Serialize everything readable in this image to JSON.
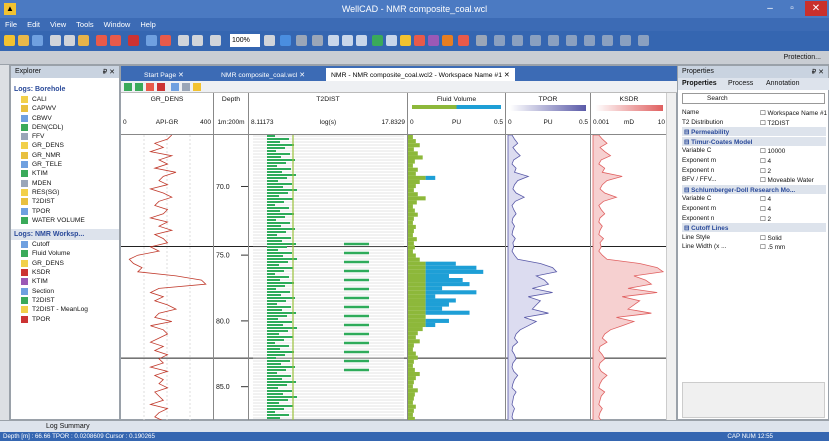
{
  "window": {
    "title": "WellCAD - NMR composite_coal.wcl",
    "minimize": "–",
    "maximize": "▫",
    "close": "✕"
  },
  "menu": [
    "File",
    "Edit",
    "View",
    "Tools",
    "Window",
    "Help"
  ],
  "toolbar": {
    "zoom": "100%"
  },
  "protection_label": "Protection...",
  "explorer": {
    "title": "Explorer",
    "pin": "₽ ✕",
    "borehole_title": "Logs: Borehole",
    "borehole_items": [
      "CALI",
      "CAPWV",
      "CBWV",
      "DEN(CDL)",
      "FFV",
      "GR_DENS",
      "GR_NMR",
      "GR_TELE",
      "KTIM",
      "MDEN",
      "RES(SG)",
      "T2DIST",
      "TPOR",
      "WATER VOLUME"
    ],
    "workspace_title": "Logs: NMR Worksp...",
    "workspace_items": [
      "Cutoff",
      "Fluid Volume",
      "GR_DENS",
      "KSDR",
      "KTIM",
      "Section",
      "T2DIST",
      "T2DIST - MeanLog",
      "TPOR"
    ]
  },
  "tabs": [
    "Start Page",
    "NMR composite_coal.wcl",
    "NMR - NMR composite_coal.wcl2 - Workspace Name #1"
  ],
  "tab_close": "✕",
  "columns": [
    {
      "name": "GR_DENS",
      "left": "0",
      "unit": "API-GR",
      "right": "400"
    },
    {
      "name": "Depth",
      "left": "",
      "unit": "1m:200m",
      "right": ""
    },
    {
      "name": "T2DIST",
      "left": "8.11173",
      "unit": "log(s)",
      "right": "17.8329"
    },
    {
      "name": "Fluid Volume",
      "left": "0",
      "unit": "PU",
      "right": "0.5"
    },
    {
      "name": "TPOR",
      "left": "0",
      "unit": "PU",
      "right": "0.5"
    },
    {
      "name": "KSDR",
      "left": "0.001",
      "unit": "mD",
      "right": "10"
    }
  ],
  "depth_labels": [
    "70.0",
    "75.0",
    "80.0",
    "85.0"
  ],
  "depth_fractions": [
    0.18,
    0.42,
    0.65,
    0.88
  ],
  "section_boundaries": [
    0.39,
    0.78
  ],
  "gr_curve": [
    0.55,
    0.5,
    0.35,
    0.45,
    0.3,
    0.55,
    0.4,
    0.5,
    0.35,
    0.6,
    0.45,
    0.4,
    0.5,
    0.3,
    0.45,
    0.55,
    0.4,
    0.35,
    0.5,
    0.45,
    0.3,
    0.5,
    0.4,
    0.55,
    0.35,
    0.45,
    0.5,
    0.3,
    0.4,
    0.15,
    0.05,
    0.1,
    0.2,
    0.15,
    0.6,
    0.9,
    0.95,
    0.4,
    0.3,
    0.45,
    0.35,
    0.5,
    0.6,
    0.4,
    0.35,
    0.55,
    0.3,
    0.45,
    0.5,
    0.4,
    0.3,
    0.45,
    0.35,
    0.5,
    0.4,
    0.45,
    0.3,
    0.5,
    0.35,
    0.45,
    0.4,
    0.5,
    0.35,
    0.4,
    0.45,
    0.3,
    0.5,
    0.4,
    0.35,
    0.45
  ],
  "tpor_curve": [
    0.05,
    0.08,
    0.12,
    0.06,
    0.1,
    0.15,
    0.07,
    0.05,
    0.1,
    0.08,
    0.25,
    0.12,
    0.08,
    0.06,
    0.1,
    0.2,
    0.09,
    0.05,
    0.07,
    0.1,
    0.06,
    0.05,
    0.08,
    0.06,
    0.05,
    0.09,
    0.06,
    0.07,
    0.05,
    0.08,
    0.12,
    0.4,
    0.55,
    0.6,
    0.35,
    0.45,
    0.5,
    0.3,
    0.55,
    0.25,
    0.4,
    0.35,
    0.3,
    0.5,
    0.2,
    0.35,
    0.25,
    0.15,
    0.1,
    0.08,
    0.12,
    0.06,
    0.05,
    0.08,
    0.1,
    0.06,
    0.05,
    0.07,
    0.12,
    0.08,
    0.06,
    0.05,
    0.1,
    0.07,
    0.06,
    0.05,
    0.08,
    0.06,
    0.05,
    0.07
  ],
  "colors": {
    "gr": "#c0392b",
    "fluid_green": "#8db83a",
    "fluid_blue": "#1e9fd6",
    "tpor": "#5a5aa8",
    "ksdr": "#e06060",
    "t2": "#2eab5a",
    "accent": "#3c6bb5"
  },
  "properties": {
    "title": "Properties",
    "pin": "₽ ✕",
    "tabs": [
      "Properties",
      "Process",
      "Annotation"
    ],
    "search_placeholder": "Search",
    "rows": [
      {
        "k": "Name",
        "v": "☐ Workspace Name #1",
        "grp": false
      },
      {
        "k": "T2 Distribution",
        "v": "☐ T2DIST",
        "grp": false
      },
      {
        "k": "⊟ Permeability",
        "v": "",
        "grp": true
      },
      {
        "k": "⊟ Timur-Coates Model",
        "v": "",
        "grp": true
      },
      {
        "k": "Variable C",
        "v": "☐ 10000",
        "grp": false
      },
      {
        "k": "Exponent m",
        "v": "☐ 4",
        "grp": false
      },
      {
        "k": "Exponent n",
        "v": "☐ 2",
        "grp": false
      },
      {
        "k": "BFV / FFV...",
        "v": "☐ Moveable Water",
        "grp": false
      },
      {
        "k": "⊟ Schlumberger-Doll Research Mo...",
        "v": "",
        "grp": true
      },
      {
        "k": "Variable C",
        "v": "☐ 4",
        "grp": false
      },
      {
        "k": "Exponent m",
        "v": "☐ 4",
        "grp": false
      },
      {
        "k": "Exponent n",
        "v": "☐ 2",
        "grp": false
      },
      {
        "k": "⊟ Cutoff Lines",
        "v": "",
        "grp": true
      },
      {
        "k": "Line Style",
        "v": "☐ Solid",
        "grp": false
      },
      {
        "k": "Line Width (x ...",
        "v": "☐ .5 mm",
        "grp": false
      }
    ]
  },
  "bottom_tab": "Log Summary",
  "status": {
    "left": "Depth [m] : 66.66  TPOR : 0.0208609  Cursor : 0.190265",
    "right": "CAP NUM  12:55"
  }
}
